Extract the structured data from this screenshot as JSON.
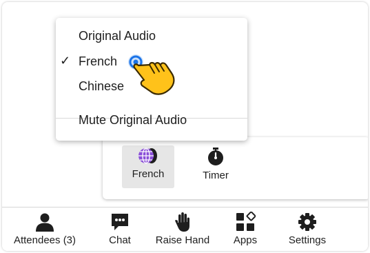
{
  "menu": {
    "items": [
      {
        "label": "Original Audio",
        "checked": false
      },
      {
        "label": "French",
        "checked": true
      },
      {
        "label": "Chinese",
        "checked": false
      }
    ],
    "check_mark": "✓",
    "mute_label": "Mute Original Audio"
  },
  "subpanel": {
    "items": [
      {
        "label": "French",
        "icon": "globe-icon",
        "active": true
      },
      {
        "label": "Timer",
        "icon": "timer-icon",
        "active": false
      }
    ]
  },
  "toolbar": {
    "items": [
      {
        "label": "Attendees (3)",
        "icon": "attendees-icon"
      },
      {
        "label": "Chat",
        "icon": "chat-icon"
      },
      {
        "label": "Raise Hand",
        "icon": "raise-hand-icon"
      },
      {
        "label": "Apps",
        "icon": "apps-icon"
      },
      {
        "label": "Settings",
        "icon": "settings-icon"
      }
    ]
  },
  "colors": {
    "globe": "#8a4fd8",
    "cursor_ring": "#1a73e8",
    "hand_fill": "#ffc21a"
  }
}
